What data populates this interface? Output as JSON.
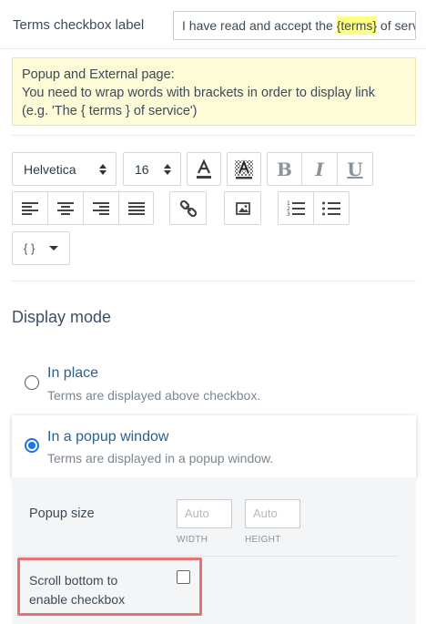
{
  "terms_row": {
    "label": "Terms checkbox label",
    "value_prefix": "I have read and accept the ",
    "value_highlight": "{terms}",
    "value_suffix": " of service"
  },
  "note": {
    "line1": "Popup and External page:",
    "line2": "You need to wrap words with brackets in order to display link",
    "line3": "(e.g. 'The { terms } of service')"
  },
  "toolbar": {
    "font_family": "Helvetica",
    "font_size": "16",
    "bold_glyph": "B",
    "italic_glyph": "I",
    "underline_glyph": "U",
    "variable_glyph": "{ }",
    "icons": [
      "text-color-icon",
      "highlight-color-icon",
      "bold-icon",
      "italic-icon",
      "underline-icon",
      "align-left-icon",
      "align-center-icon",
      "align-right-icon",
      "align-justify-icon",
      "link-icon",
      "image-icon",
      "ordered-list-icon",
      "unordered-list-icon",
      "variables-dropdown-icon"
    ]
  },
  "display_mode": {
    "title": "Display mode",
    "options": [
      {
        "title": "In place",
        "desc": "Terms are displayed above checkbox.",
        "selected": false
      },
      {
        "title": "In a popup window",
        "desc": "Terms are displayed in a popup window.",
        "selected": true
      }
    ]
  },
  "popup": {
    "size_label": "Popup size",
    "width_placeholder": "Auto",
    "height_placeholder": "Auto",
    "width_caption": "WIDTH",
    "height_caption": "HEIGHT",
    "scroll_label": "Scroll bottom to enable checkbox",
    "scroll_checked": false
  },
  "colors": {
    "accent": "#1a73e8",
    "highlight": "#ffff80",
    "note_bg": "#fdfbd8",
    "focus_outline": "#e57373"
  }
}
